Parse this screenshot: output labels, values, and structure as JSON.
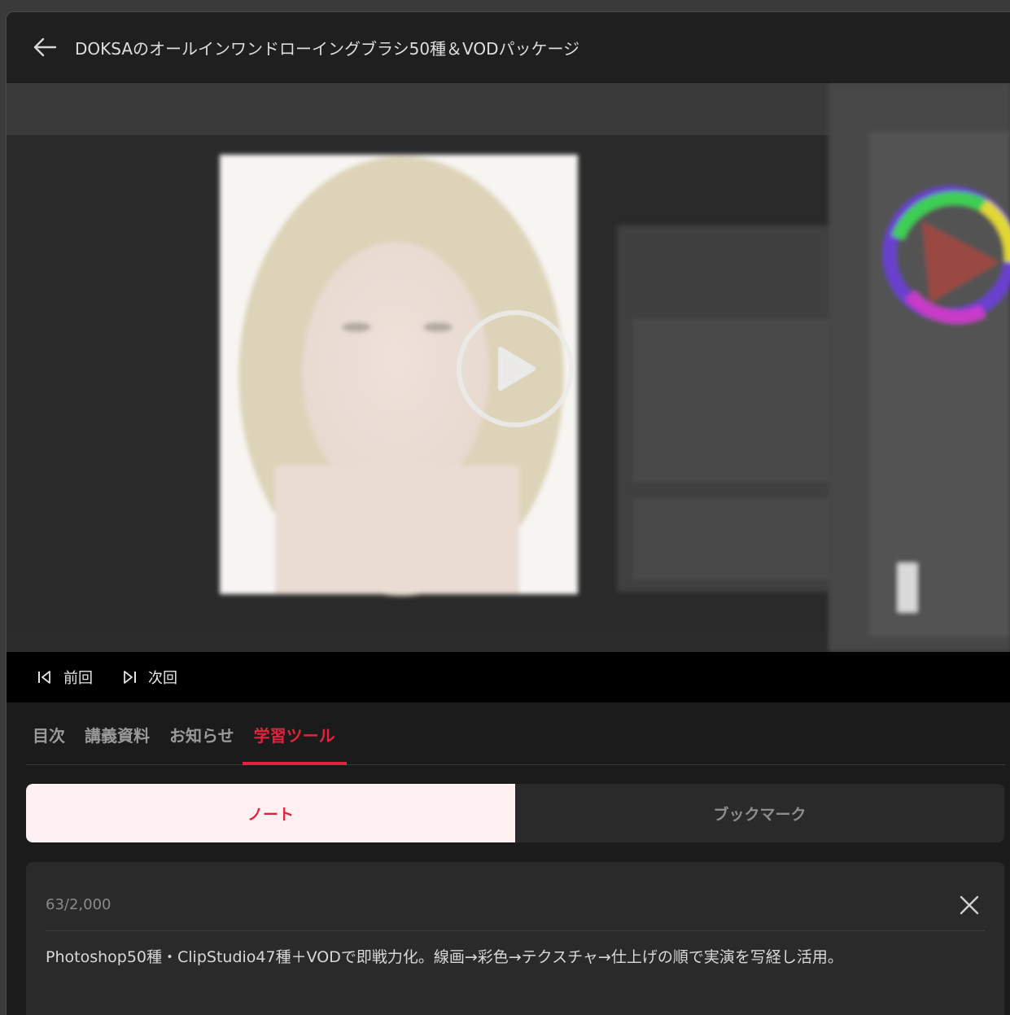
{
  "header": {
    "title": "DOKSAのオールインワンドローイングブラシ50種＆VODパッケージ"
  },
  "player": {
    "prev_label": "前回",
    "next_label": "次回"
  },
  "tabs": [
    {
      "label": "目次"
    },
    {
      "label": "講義資料"
    },
    {
      "label": "お知らせ"
    },
    {
      "label": "学習ツール"
    }
  ],
  "segments": [
    {
      "label": "ノート"
    },
    {
      "label": "ブックマーク"
    }
  ],
  "note": {
    "counter": "63/2,000",
    "text": "Photoshop50種・ClipStudio47種＋VODで即戦力化。線画→彩色→テクスチャ→仕上げの順で実演を写経し活用。"
  },
  "colors": {
    "accent": "#e2233e",
    "active_segment_bg": "#fff1f1"
  }
}
